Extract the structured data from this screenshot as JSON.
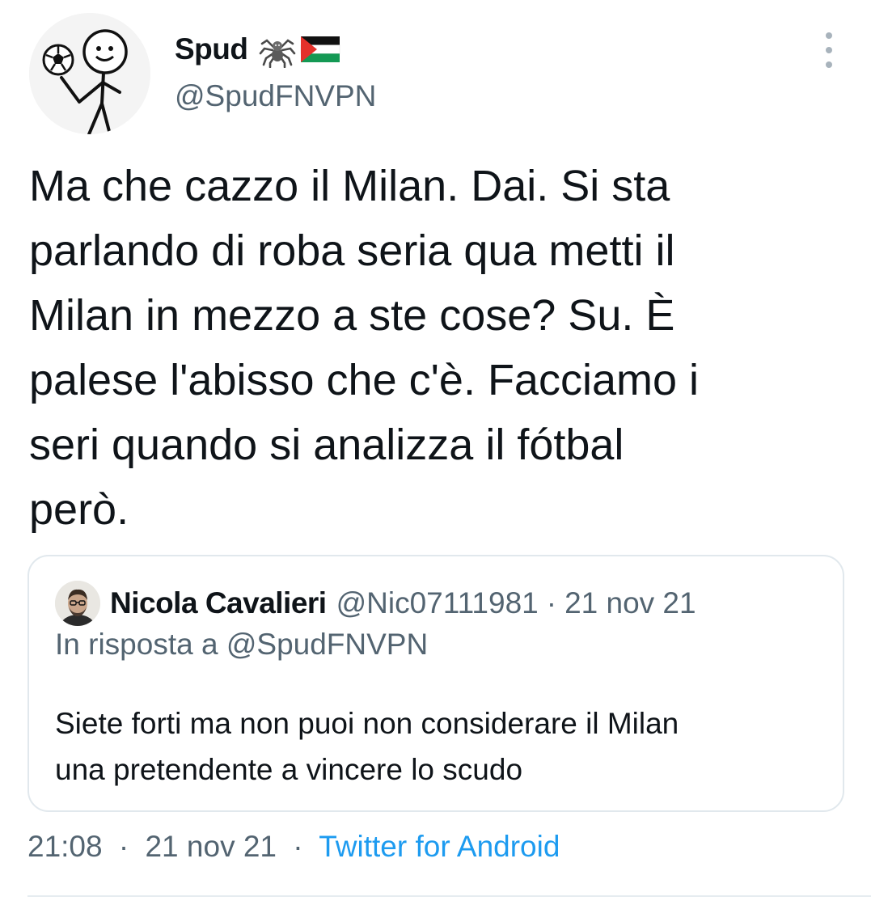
{
  "author": {
    "display_name": "Spud",
    "emoji_1": "spider-emoji",
    "emoji_2": "palestine-flag-emoji",
    "handle": "@SpudFNVPN"
  },
  "tweet": {
    "text_lines": [
      "Ma che cazzo il Milan. Dai. Si sta",
      "parlando di roba seria qua metti il",
      "Milan in mezzo a ste cose? Su. È",
      "palese l'abisso che c'è. Facciamo i",
      "seri quando si analizza il fótbal",
      "però."
    ]
  },
  "quoted_tweet": {
    "display_name": "Nicola Cavalieri",
    "handle": "@Nic07111981",
    "separator": "·",
    "date": "21 nov 21",
    "reply_context": "In risposta a @SpudFNVPN",
    "text_lines": [
      "Siete forti ma non puoi non considerare il Milan",
      "una pretendente a vincere lo scudo"
    ]
  },
  "meta": {
    "time": "21:08",
    "separator": "·",
    "date": "21 nov 21",
    "source": "Twitter for Android"
  },
  "colors": {
    "text_primary": "#0f1419",
    "text_secondary": "#536471",
    "link": "#1d9bf0",
    "border": "#e1e8ed"
  },
  "icons": {
    "more": "more-vertical-icon"
  }
}
